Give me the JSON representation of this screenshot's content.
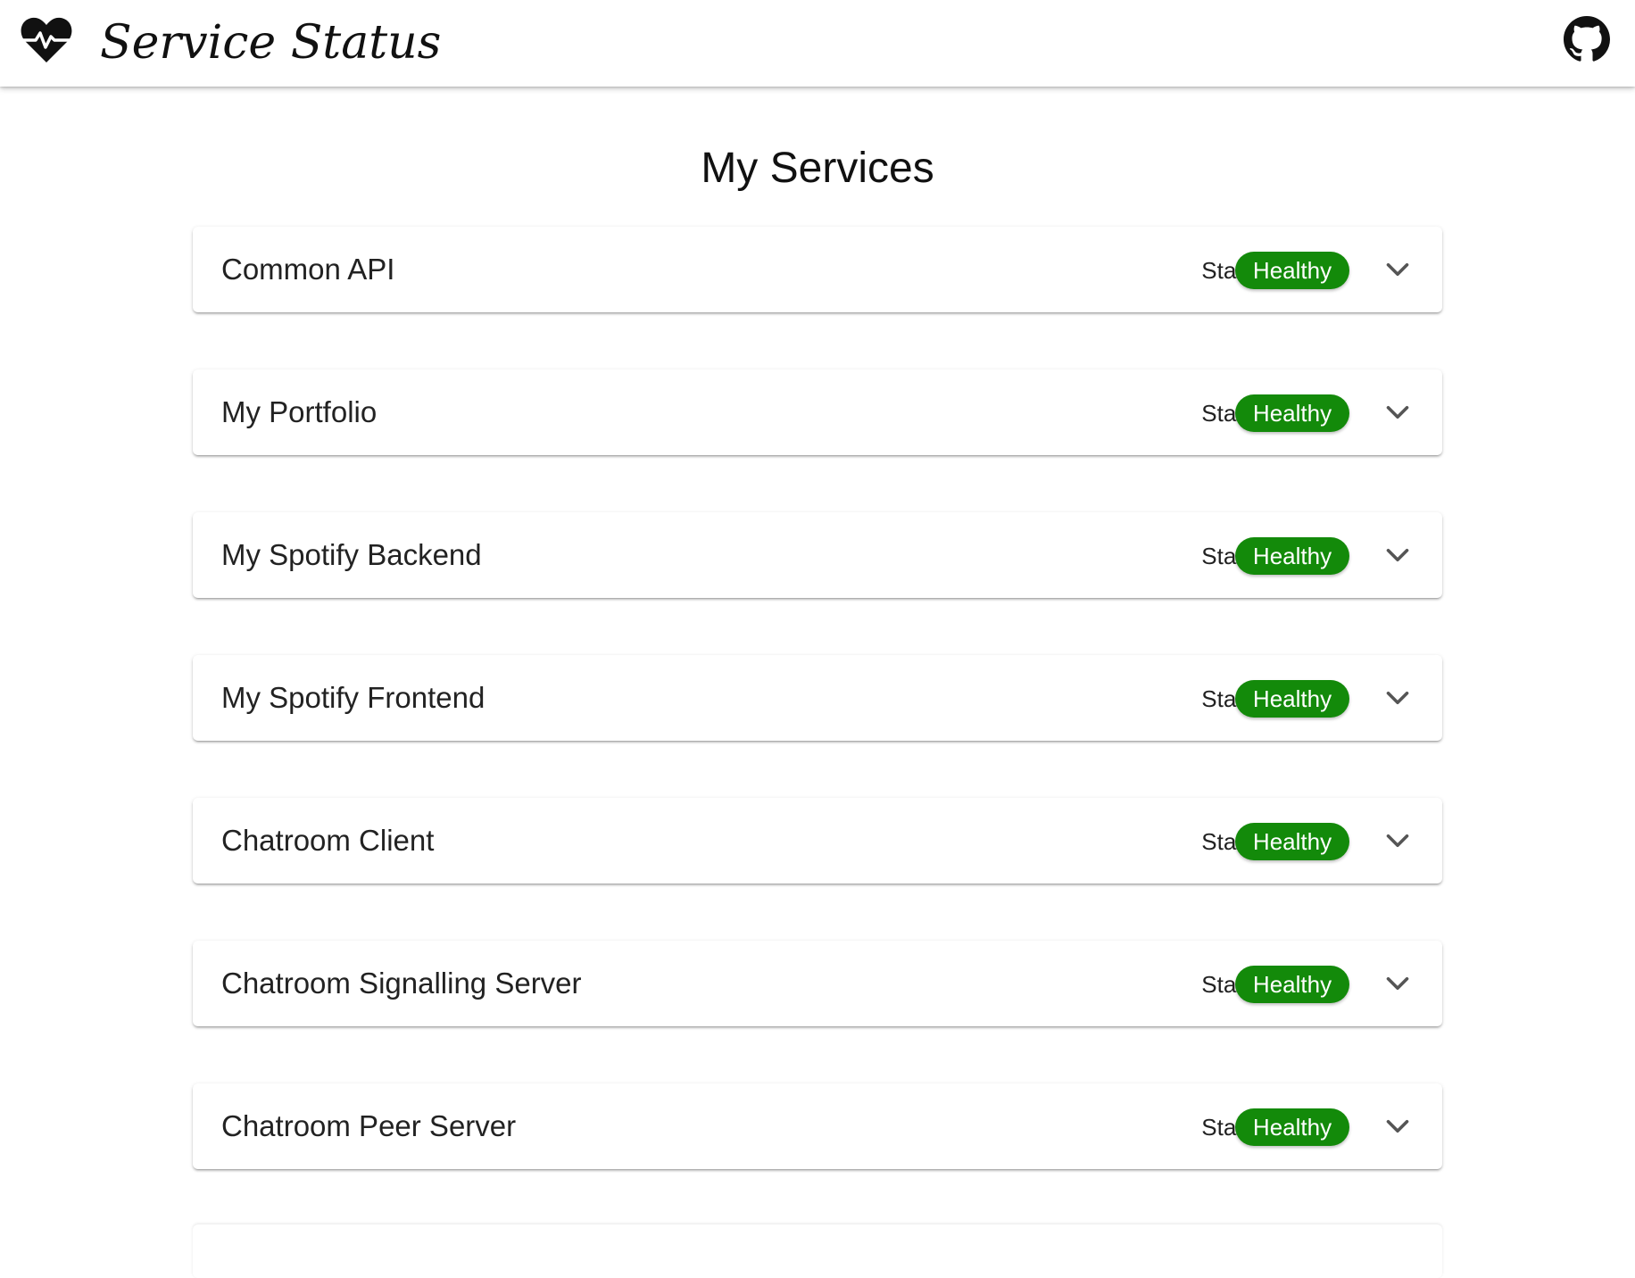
{
  "header": {
    "app_title": "Service Status",
    "logo_icon": "heart-pulse-icon",
    "github_icon": "github-icon"
  },
  "main": {
    "page_title": "My Services",
    "status_label": "Status",
    "expand_icon": "chevron-down-icon",
    "services": [
      {
        "name": "Common API",
        "status": "Healthy"
      },
      {
        "name": "My Portfolio",
        "status": "Healthy"
      },
      {
        "name": "My Spotify Backend",
        "status": "Healthy"
      },
      {
        "name": "My Spotify Frontend",
        "status": "Healthy"
      },
      {
        "name": "Chatroom Client",
        "status": "Healthy"
      },
      {
        "name": "Chatroom Signalling Server",
        "status": "Healthy"
      },
      {
        "name": "Chatroom Peer Server",
        "status": "Healthy"
      }
    ]
  },
  "colors": {
    "healthy": "#138a0a",
    "text": "#222222",
    "background": "#ffffff"
  }
}
